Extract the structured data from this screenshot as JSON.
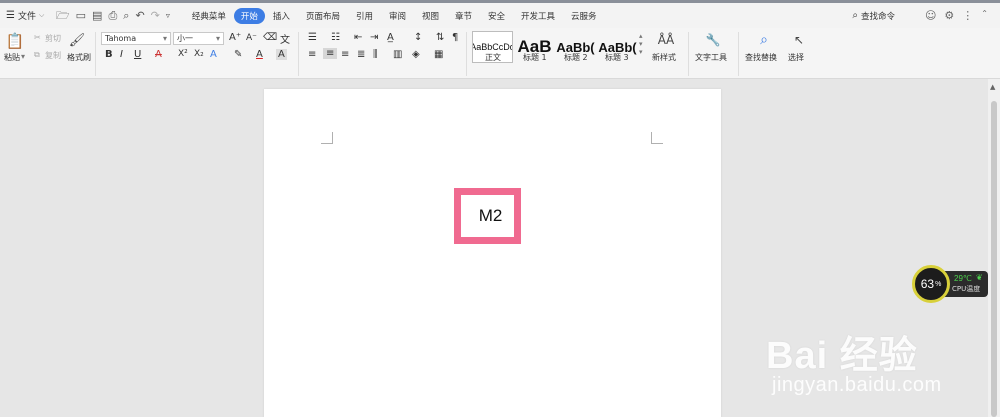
{
  "menubar": {
    "file_label": "文件",
    "tabs": [
      "经典菜单",
      "开始",
      "插入",
      "页面布局",
      "引用",
      "审阅",
      "视图",
      "章节",
      "安全",
      "开发工具",
      "云服务"
    ],
    "active_tab": "开始",
    "search_label": "查找命令"
  },
  "ribbon": {
    "paste_label": "粘贴",
    "cut_label": "剪切",
    "copy_label": "复制",
    "format_painter_label": "格式刷",
    "font_name": "Tahoma",
    "font_size": "小一",
    "styles": [
      {
        "preview": "AaBbCcDd",
        "label": "正文"
      },
      {
        "preview": "AaB",
        "label": "标题 1"
      },
      {
        "preview": "AaBb(",
        "label": "标题 2"
      },
      {
        "preview": "AaBb(",
        "label": "标题 3"
      }
    ],
    "new_style_label": "新样式",
    "text_tools_label": "文字工具",
    "find_replace_label": "查找替换",
    "select_label": "选择"
  },
  "document": {
    "text": "M2",
    "highlight_color": "#f06a90"
  },
  "cpu_widget": {
    "usage": "63",
    "usage_unit": "%",
    "temp": "29℃",
    "label": "CPU温度"
  },
  "watermark": {
    "logo": "Bai 经验",
    "url": "jingyan.baidu.com"
  },
  "colors": {
    "accent": "#3d7de4",
    "highlight": "#f06a90"
  }
}
